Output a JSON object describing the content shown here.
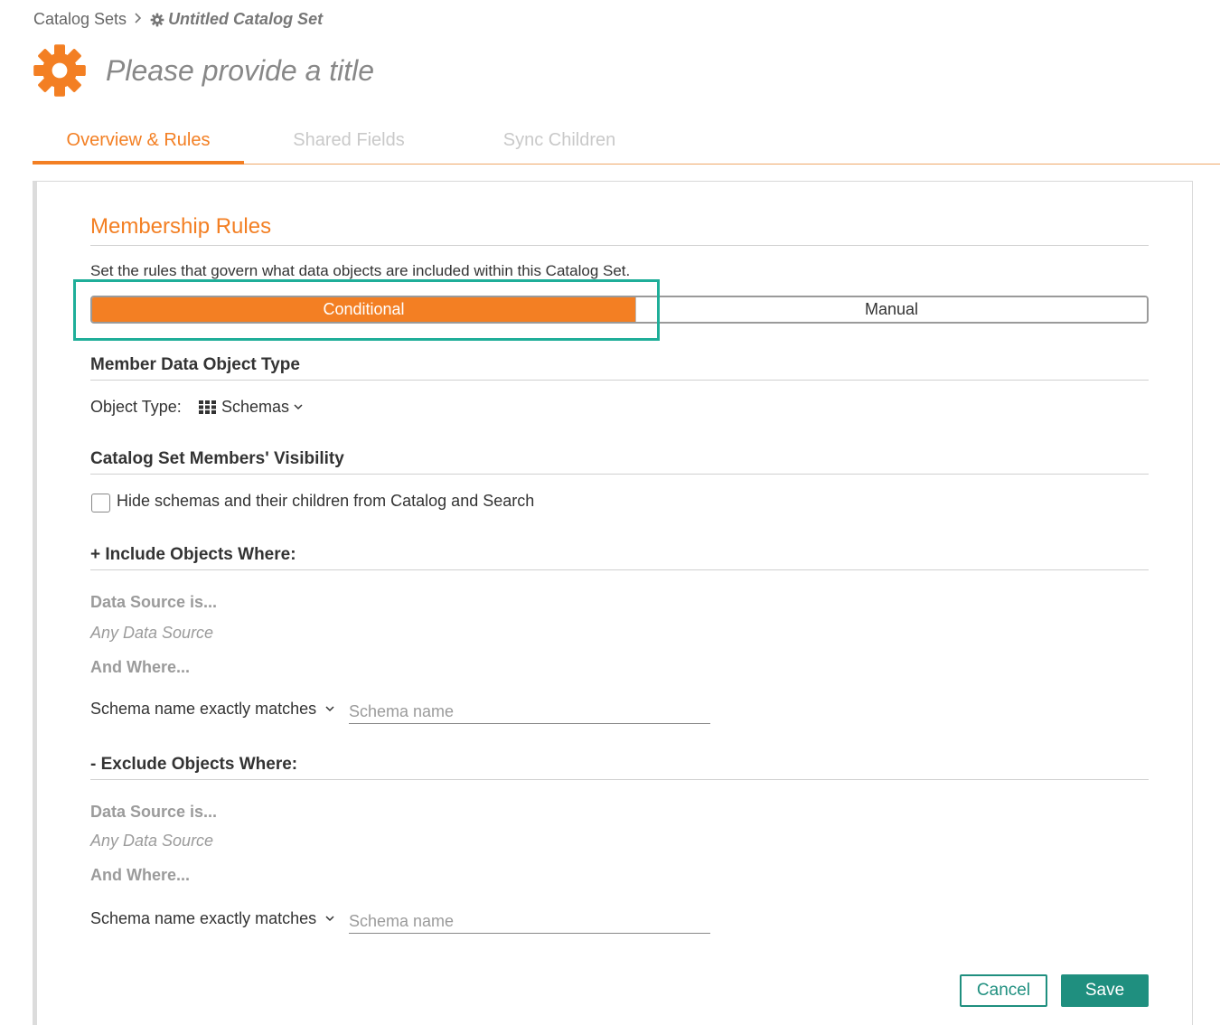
{
  "breadcrumb": {
    "parent": "Catalog Sets",
    "separator": ">",
    "current": "Untitled Catalog Set"
  },
  "header": {
    "title_placeholder": "Please provide a title"
  },
  "tabs": [
    {
      "label": "Overview & Rules",
      "active": true
    },
    {
      "label": "Shared Fields",
      "active": false
    },
    {
      "label": "Sync Children",
      "active": false
    }
  ],
  "membership": {
    "title": "Membership Rules",
    "description": "Set the rules that govern what data objects are included within this Catalog Set.",
    "toggle": {
      "conditional": "Conditional",
      "manual": "Manual",
      "selected": "Conditional"
    }
  },
  "object_type": {
    "section_title": "Member Data Object Type",
    "label": "Object Type:",
    "value": "Schemas"
  },
  "visibility": {
    "section_title": "Catalog Set Members' Visibility",
    "checkbox_label": "Hide schemas and their children from Catalog and Search",
    "checked": false
  },
  "include": {
    "section_title": "+ Include Objects Where:",
    "data_source_label": "Data Source is...",
    "data_source_value": "Any Data Source",
    "and_where_label": "And Where...",
    "condition_select": "Schema name exactly matches",
    "input_placeholder": "Schema name"
  },
  "exclude": {
    "section_title": "- Exclude Objects Where:",
    "data_source_label": "Data Source is...",
    "data_source_value": "Any Data Source",
    "and_where_label": "And Where...",
    "condition_select": "Schema name exactly matches",
    "input_placeholder": "Schema name"
  },
  "actions": {
    "cancel": "Cancel",
    "save": "Save"
  },
  "colors": {
    "accent": "#f37f23",
    "primary_button": "#1f8f7f",
    "highlight": "#1fae99"
  },
  "icons": {
    "breadcrumb_separator": "chevron-right-icon",
    "breadcrumb_current": "gear-icon",
    "header": "gear-icon",
    "object_type": "grid-icon",
    "dropdown": "chevron-down-icon"
  }
}
